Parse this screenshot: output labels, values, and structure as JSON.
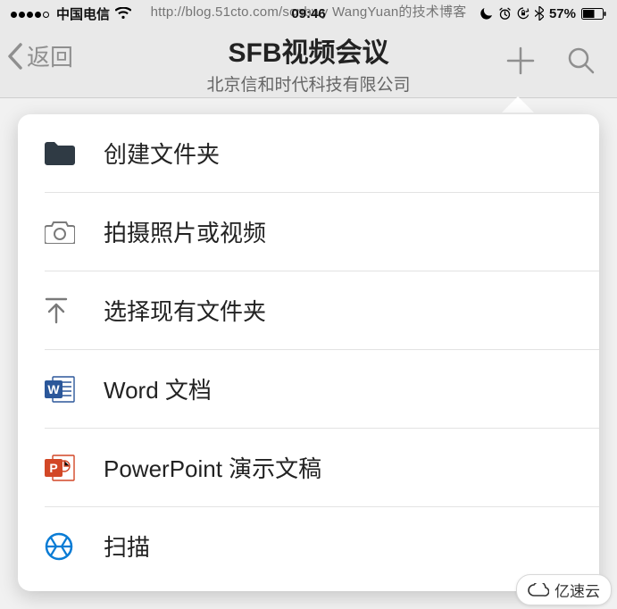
{
  "watermark": {
    "top_text": "http://blog.51cto.com/scnbwy WangYuan的技术博客",
    "logo_text": "亿速云"
  },
  "status_bar": {
    "carrier": "中国电信",
    "time": "09:46",
    "battery_text": "57%"
  },
  "header": {
    "back_label": "返回",
    "title": "SFB视频会议",
    "subtitle": "北京信和时代科技有限公司"
  },
  "menu": {
    "items": [
      {
        "id": "create-folder",
        "label": "创建文件夹"
      },
      {
        "id": "take-photo-video",
        "label": "拍摄照片或视频"
      },
      {
        "id": "choose-folder",
        "label": "选择现有文件夹"
      },
      {
        "id": "word-doc",
        "label": "Word 文档"
      },
      {
        "id": "powerpoint-doc",
        "label": "PowerPoint 演示文稿"
      },
      {
        "id": "scan",
        "label": "扫描"
      }
    ]
  }
}
